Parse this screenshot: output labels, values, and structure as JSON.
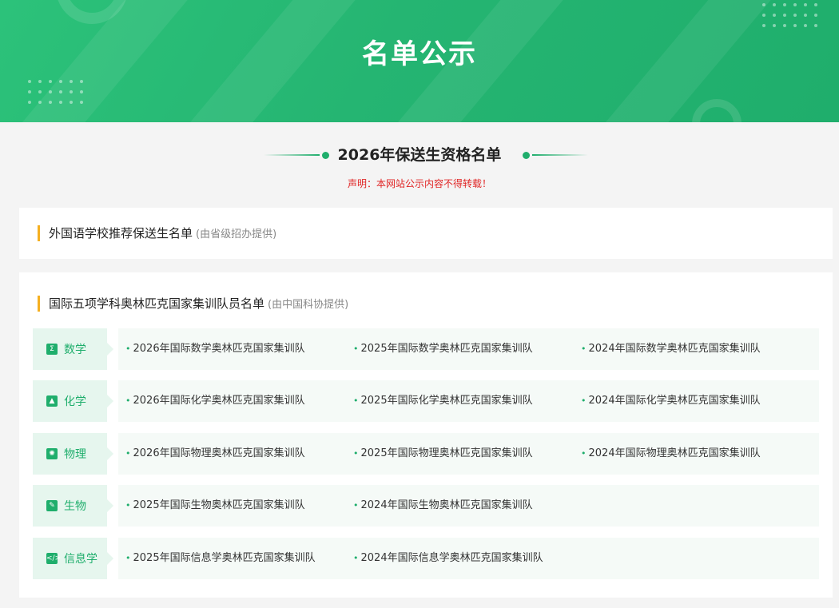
{
  "banner": {
    "title": "名单公示"
  },
  "section": {
    "title": "2026年保送生资格名单",
    "notice": "声明：本网站公示内容不得转载！"
  },
  "cards": {
    "foreign": {
      "title": "外国语学校推荐保送生名单",
      "note": "(由省级招办提供)"
    },
    "olympiad": {
      "title": "国际五项学科奥林匹克国家集训队员名单",
      "note": "(由中国科协提供)"
    }
  },
  "subjects": [
    {
      "name": "数学",
      "icon": "sigma-icon",
      "links": [
        "2026年国际数学奥林匹克国家集训队",
        "2025年国际数学奥林匹克国家集训队",
        "2024年国际数学奥林匹克国家集训队"
      ]
    },
    {
      "name": "化学",
      "icon": "flask-icon",
      "links": [
        "2026年国际化学奥林匹克国家集训队",
        "2025年国际化学奥林匹克国家集训队",
        "2024年国际化学奥林匹克国家集训队"
      ]
    },
    {
      "name": "物理",
      "icon": "atom-icon",
      "links": [
        "2026年国际物理奥林匹克国家集训队",
        "2025年国际物理奥林匹克国家集训队",
        "2024年国际物理奥林匹克国家集训队"
      ]
    },
    {
      "name": "生物",
      "icon": "leaf-icon",
      "links": [
        "2025年国际生物奥林匹克国家集训队",
        "2024年国际生物奥林匹克国家集训队"
      ]
    },
    {
      "name": "信息学",
      "icon": "code-icon",
      "links": [
        "2025年国际信息学奥林匹克国家集训队",
        "2024年国际信息学奥林匹克国家集训队"
      ]
    }
  ],
  "colors": {
    "accent": "#1fae6c",
    "tag_bg": "#e6f6ee",
    "title_bar": "#f5b021",
    "notice": "#e02424"
  }
}
